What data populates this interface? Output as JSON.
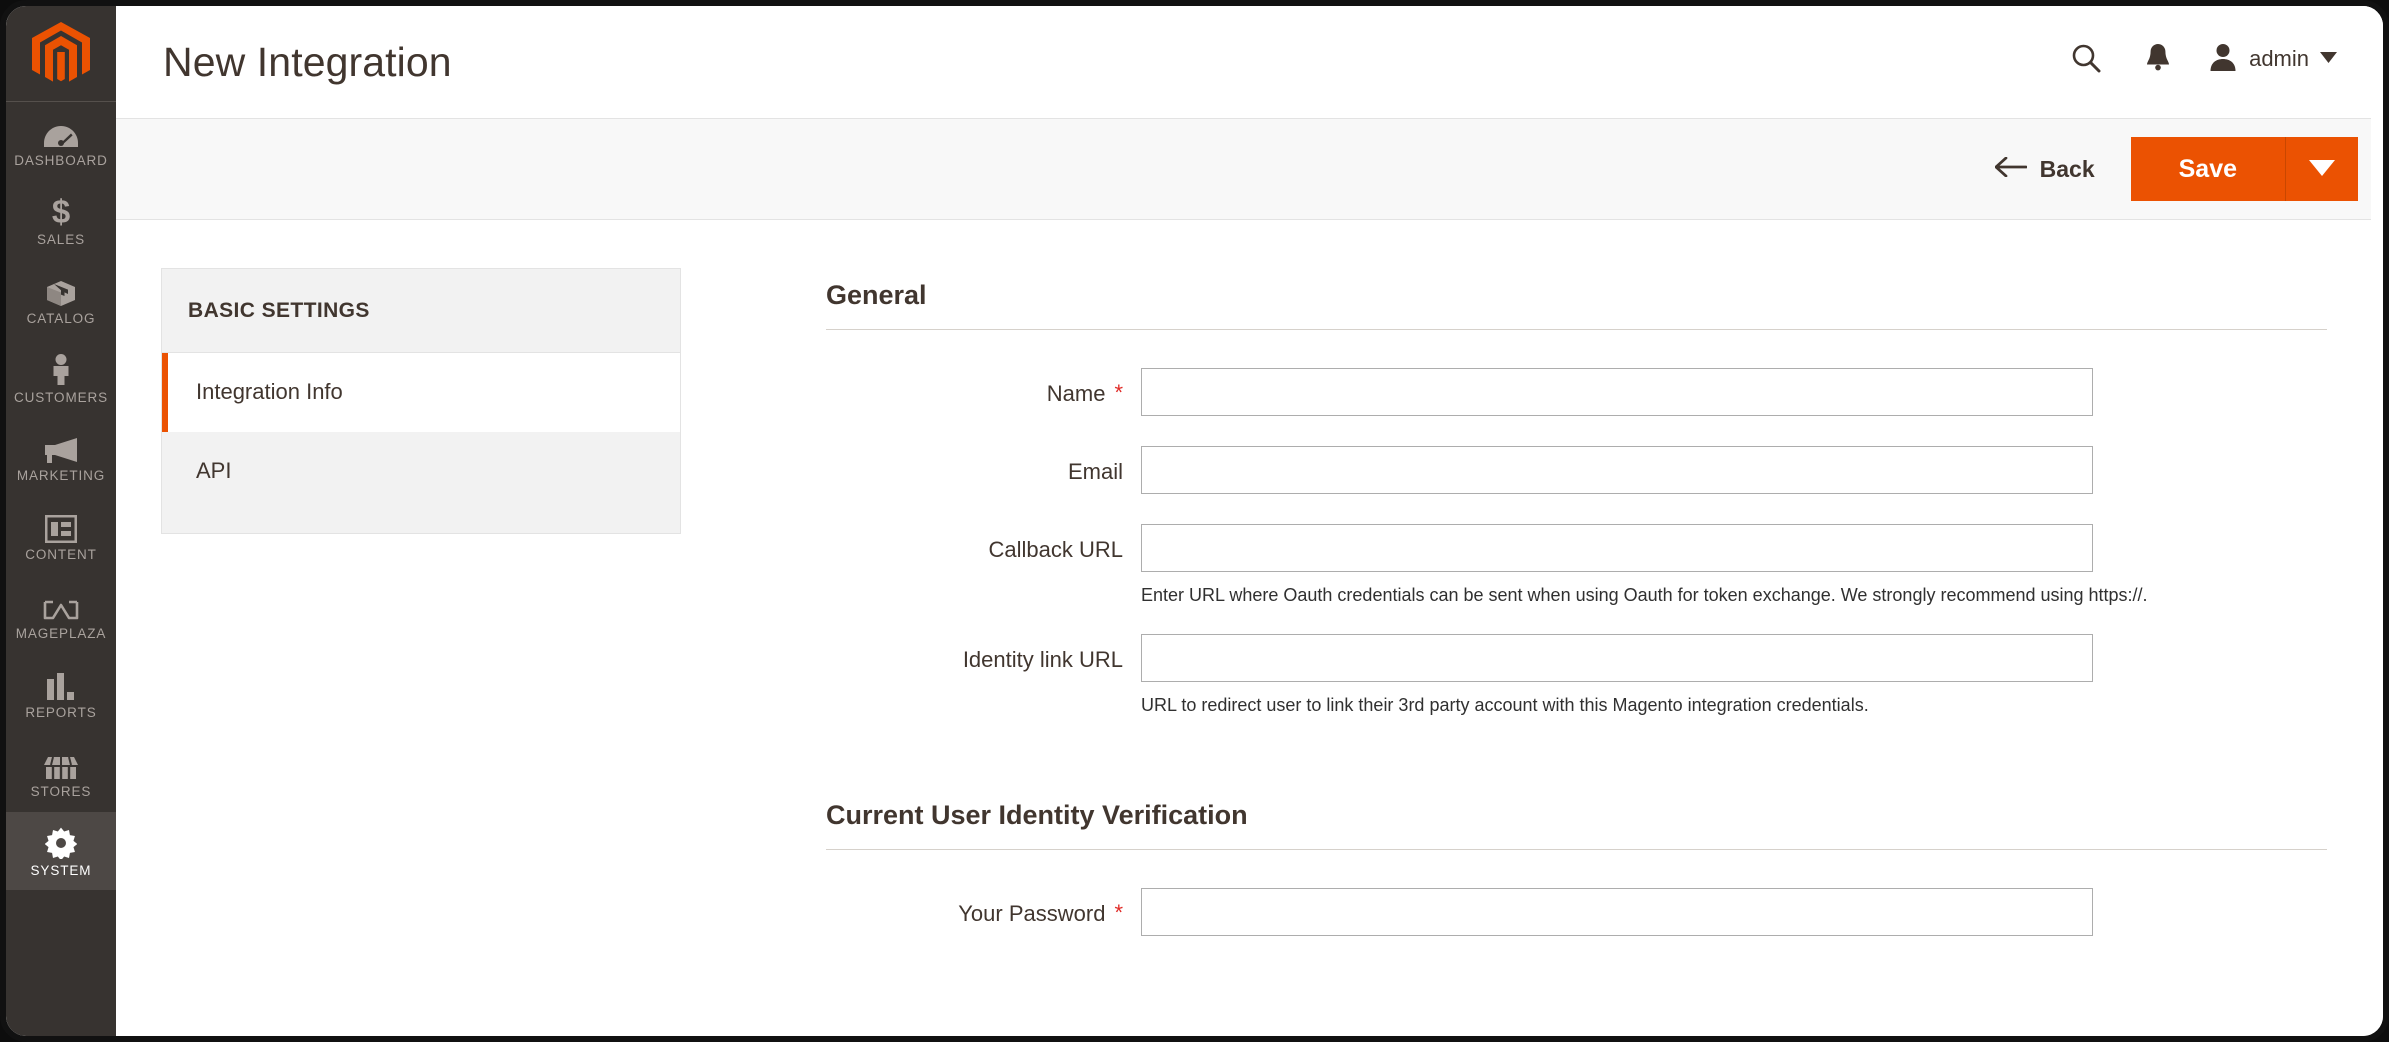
{
  "app": {
    "logo_icon": "magento-logo-icon",
    "brand_color": "#eb5202",
    "nav_bg": "#373330",
    "nav_active_bg": "#4d4845"
  },
  "sidebar": {
    "items": [
      {
        "label": "DASHBOARD",
        "icon": "dashboard-gauge-icon",
        "active": false
      },
      {
        "label": "SALES",
        "icon": "dollar-sign-icon",
        "active": false
      },
      {
        "label": "CATALOG",
        "icon": "box-package-icon",
        "active": false
      },
      {
        "label": "CUSTOMERS",
        "icon": "person-icon",
        "active": false
      },
      {
        "label": "MARKETING",
        "icon": "megaphone-icon",
        "active": false
      },
      {
        "label": "CONTENT",
        "icon": "layout-panels-icon",
        "active": false
      },
      {
        "label": "MAGEPLAZA",
        "icon": "mageplaza-icon",
        "active": false
      },
      {
        "label": "REPORTS",
        "icon": "bar-chart-icon",
        "active": false
      },
      {
        "label": "STORES",
        "icon": "storefront-icon",
        "active": false
      },
      {
        "label": "SYSTEM",
        "icon": "gear-icon",
        "active": true
      }
    ]
  },
  "header": {
    "title": "New Integration",
    "search_icon": "search-icon",
    "notifications_icon": "bell-icon",
    "account_icon": "user-avatar-icon",
    "account_name": "admin",
    "account_caret_icon": "chevron-down-icon"
  },
  "toolbar": {
    "back_label": "Back",
    "back_icon": "arrow-left-icon",
    "save_label": "Save",
    "save_caret_icon": "caret-down-icon"
  },
  "tabs": {
    "heading": "BASIC SETTINGS",
    "items": [
      {
        "label": "Integration Info",
        "active": true
      },
      {
        "label": "API",
        "active": false
      }
    ]
  },
  "form": {
    "sections": [
      {
        "title": "General",
        "fields": [
          {
            "label": "Name",
            "required": true,
            "value": "",
            "placeholder": "",
            "note": ""
          },
          {
            "label": "Email",
            "required": false,
            "value": "",
            "placeholder": "",
            "note": ""
          },
          {
            "label": "Callback URL",
            "required": false,
            "value": "",
            "placeholder": "",
            "note": "Enter URL where Oauth credentials can be sent when using Oauth for token exchange. We strongly recommend using https://."
          },
          {
            "label": "Identity link URL",
            "required": false,
            "value": "",
            "placeholder": "",
            "note": "URL to redirect user to link their 3rd party account with this Magento integration credentials."
          }
        ]
      },
      {
        "title": "Current User Identity Verification",
        "fields": [
          {
            "label": "Your Password",
            "required": true,
            "value": "",
            "placeholder": "",
            "note": ""
          }
        ]
      }
    ]
  }
}
